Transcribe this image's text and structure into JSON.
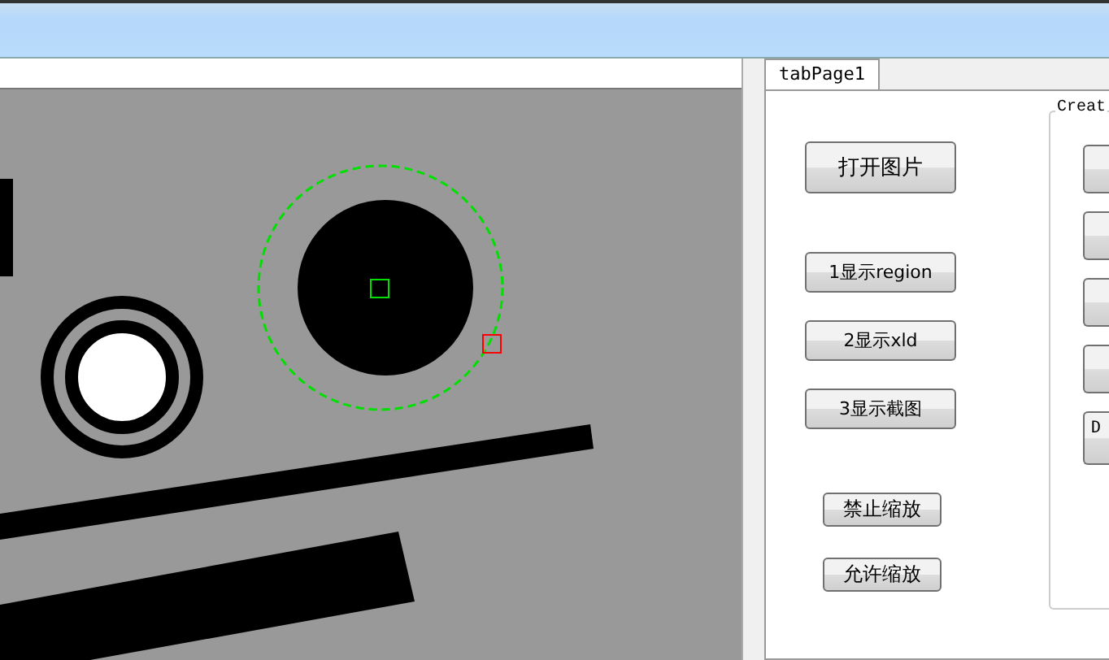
{
  "tab": {
    "label": "tabPage1",
    "selected": true
  },
  "buttons": [
    {
      "label": "打开图片",
      "kind": "large"
    },
    {
      "label": "1显示region",
      "kind": "medium"
    },
    {
      "label": "2显示xld",
      "kind": "medium"
    },
    {
      "label": "3显示截图",
      "kind": "medium"
    },
    {
      "label": "禁止缩放",
      "kind": "small"
    },
    {
      "label": "允许缩放",
      "kind": "small"
    }
  ],
  "group": {
    "title": "Creat",
    "buttons": [
      {
        "kind": "blank"
      },
      {
        "kind": "blank"
      },
      {
        "kind": "blank"
      },
      {
        "kind": "blank"
      },
      {
        "kind": "text",
        "label": "D"
      }
    ]
  }
}
